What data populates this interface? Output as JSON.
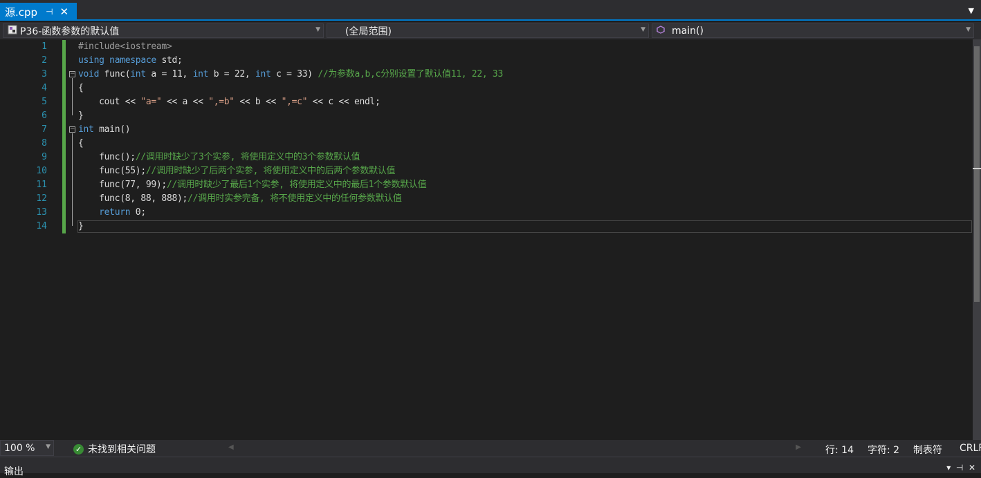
{
  "tab": {
    "title": "源.cpp",
    "pin_icon": "pin-icon",
    "close_icon": "close-icon"
  },
  "nav": {
    "project": "P36-函数参数的默认值",
    "scope": "(全局范围)",
    "member": "main()"
  },
  "editor": {
    "line_numbers": [
      "1",
      "2",
      "3",
      "4",
      "5",
      "6",
      "7",
      "8",
      "9",
      "10",
      "11",
      "12",
      "13",
      "14"
    ],
    "lines": [
      "#include<iostream>",
      "using namespace std;",
      "void func(int a = 11, int b = 22, int c = 33) //为参数a,b,c分别设置了默认值11, 22, 33",
      "{",
      "    cout << \"a=\" << a << \",=b\" << b << \",=c\" << c << endl;",
      "}",
      "int main()",
      "{",
      "    func();//调用时缺少了3个实参, 将使用定义中的3个参数默认值",
      "    func(55);//调用时缺少了后两个实参, 将使用定义中的后两个参数默认值",
      "    func(77, 99);//调用时缺少了最后1个实参, 将使用定义中的最后1个参数默认值",
      "    func(8, 88, 888);//调用时实参完备, 将不使用定义中的任何参数默认值",
      "    return 0;",
      "}"
    ],
    "current_line": 14
  },
  "status": {
    "zoom": "100 %",
    "issues": "未找到相关问题",
    "line": "行: 14",
    "char": "字符: 2",
    "tab_mode": "制表符",
    "eol": "CRLF"
  },
  "output": {
    "label": "输出"
  },
  "colors": {
    "accent": "#007acc",
    "keyword": "#569cd6",
    "string": "#d69d85",
    "comment": "#57a64a",
    "line_number": "#2b91af"
  }
}
